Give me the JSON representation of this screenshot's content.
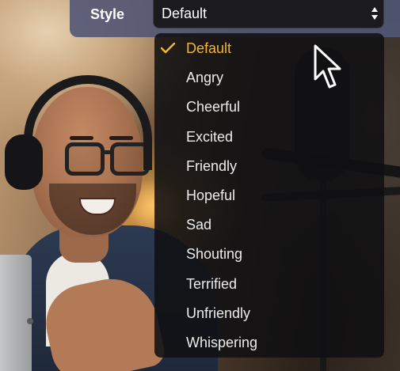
{
  "style_selector": {
    "label": "Style",
    "selected_value": "Default",
    "options": [
      {
        "label": "Default",
        "selected": true
      },
      {
        "label": "Angry",
        "selected": false
      },
      {
        "label": "Cheerful",
        "selected": false
      },
      {
        "label": "Excited",
        "selected": false
      },
      {
        "label": "Friendly",
        "selected": false
      },
      {
        "label": "Hopeful",
        "selected": false
      },
      {
        "label": "Sad",
        "selected": false
      },
      {
        "label": "Shouting",
        "selected": false
      },
      {
        "label": "Terrified",
        "selected": false
      },
      {
        "label": "Unfriendly",
        "selected": false
      },
      {
        "label": "Whispering",
        "selected": false
      }
    ]
  },
  "icons": {
    "select_arrows": "up-down-arrows-icon",
    "selected_marker": "checkmark-icon",
    "pointer": "mouse-cursor-icon"
  },
  "colors": {
    "selected_accent": "#f5b52e",
    "menu_background": "#101012",
    "label_bar": "#525676"
  }
}
